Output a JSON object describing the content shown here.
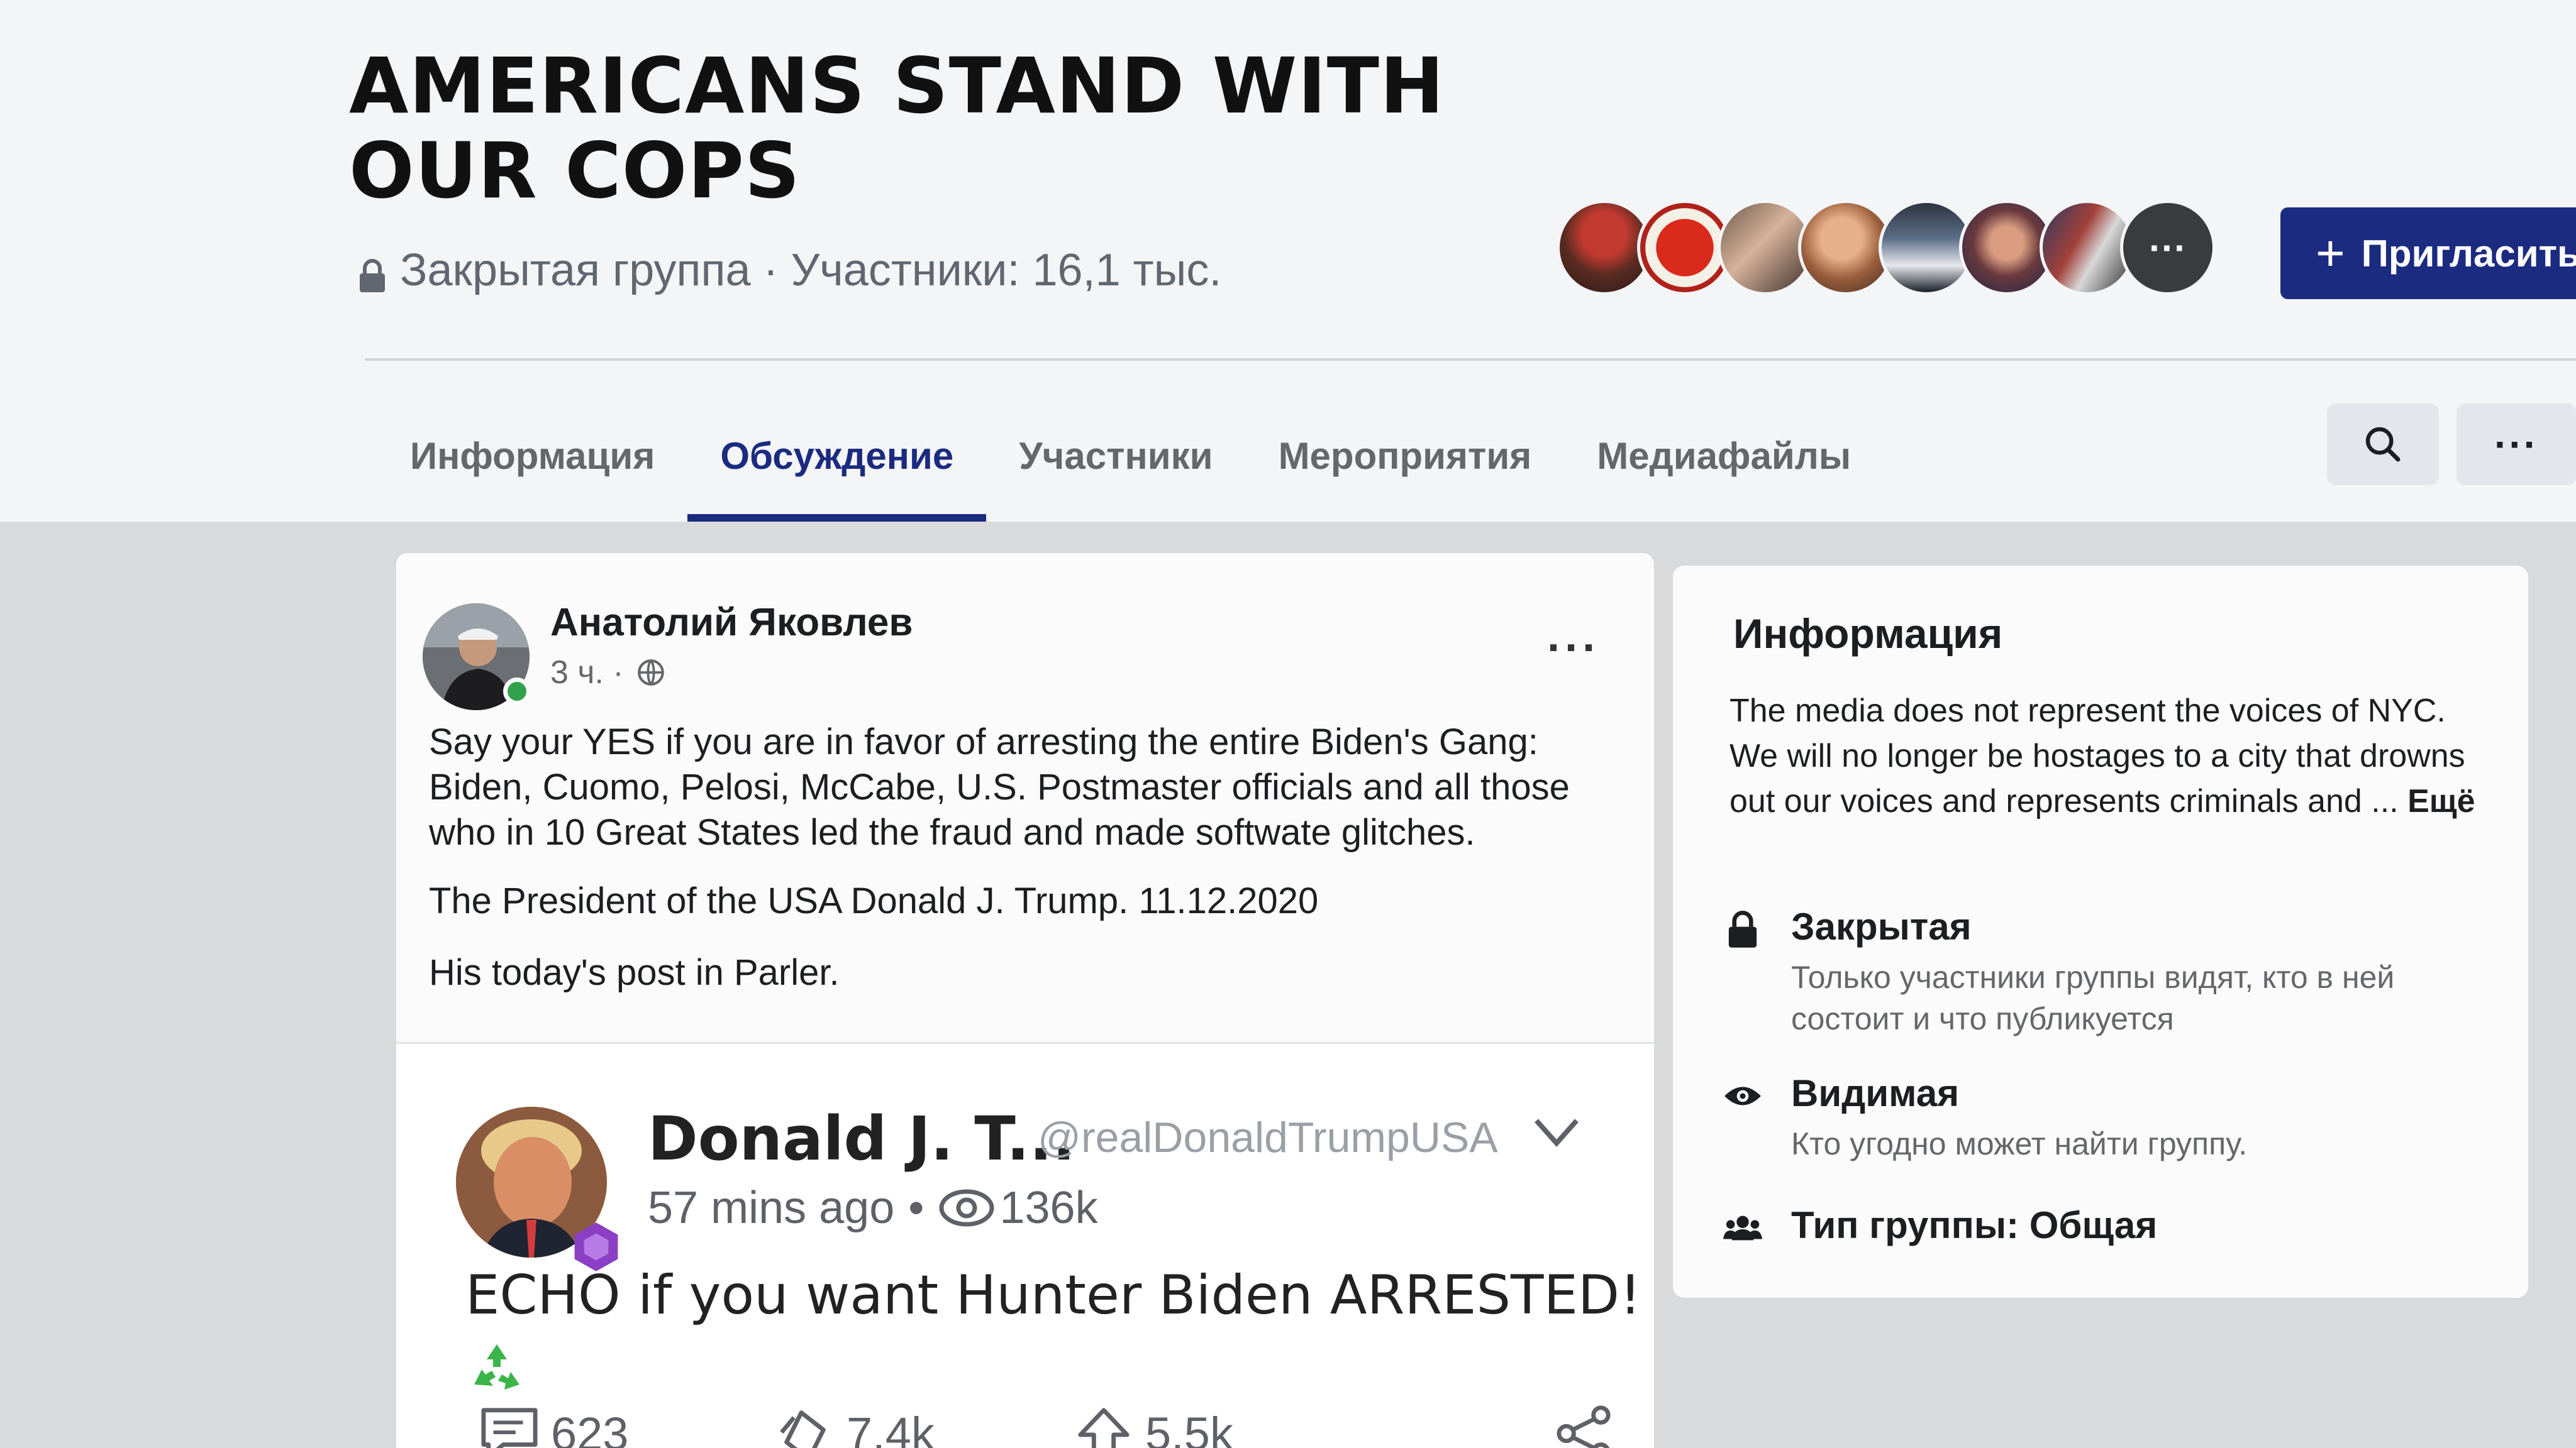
{
  "group": {
    "title": "AMERICANS STAND WITH OUR COPS",
    "privacy": "Закрытая группа",
    "separator": " · ",
    "members": "Участники: 16,1 тыс.",
    "invite_label": "Пригласить",
    "member_avatars_more": "···"
  },
  "tabs": [
    {
      "label": "Информация",
      "active": false
    },
    {
      "label": "Обсуждение",
      "active": true
    },
    {
      "label": "Участники",
      "active": false
    },
    {
      "label": "Мероприятия",
      "active": false
    },
    {
      "label": "Медиафайлы",
      "active": false
    }
  ],
  "toolbar": {
    "search_icon": "search-icon",
    "more_icon": "more-horizontal-icon",
    "more_label": "···"
  },
  "post": {
    "author": "Анатолий Яковлев",
    "time": "3 ч. ·",
    "audience_icon": "globe-icon",
    "menu_label": "···",
    "body": "Say your YES if you are in favor of arresting the entire Biden's Gang: Biden, Cuomo, Pelosi, McCabe, U.S. Postmaster officials and all those who in 10 Great States led the fraud and made softwate glitches.",
    "line2": "The President of the USA Donald J. Trump. 11.12.2020",
    "line3": "His today's post in Parler."
  },
  "embed": {
    "name": "Donald J. T...",
    "handle": "@realDonaldTrumpUSA",
    "time": "57 mins ago",
    "dot": "•",
    "views": "136k",
    "text": "ECHO if you want Hunter Biden ARRESTED!",
    "comments": "623",
    "echoes": "7.4k",
    "upvotes": "5.5k"
  },
  "info": {
    "title": "Информация",
    "description": "The media does not represent the voices of NYC. We will no longer be hostages to a city that drowns out our voices and represents criminals and ...",
    "more_label": "Ещё",
    "closed_title": "Закрытая",
    "closed_desc": "Только участники группы видят, кто в ней состоит и что публикуется",
    "visible_title": "Видимая",
    "visible_desc": "Кто угодно может найти группу.",
    "type_label": "Тип группы: Общая"
  },
  "colors": {
    "accent": "#1b2b80",
    "online": "#31a24c",
    "badge": "#8a3fc4",
    "recycle": "#3bb54a"
  }
}
